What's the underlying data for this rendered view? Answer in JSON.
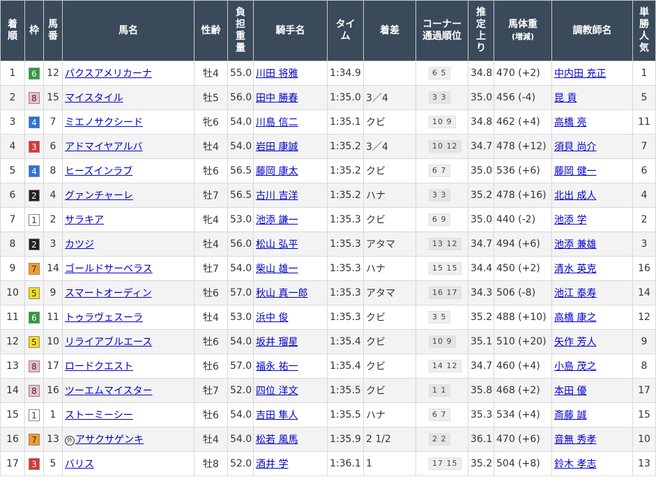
{
  "headers": {
    "rank": [
      "着",
      "順"
    ],
    "waku": [
      "枠"
    ],
    "umaban": [
      "馬",
      "番"
    ],
    "horse": [
      "馬名"
    ],
    "sexage": [
      "性齢"
    ],
    "weight": [
      "負",
      "担",
      "重",
      "量"
    ],
    "jockey": [
      "騎手名"
    ],
    "time": [
      "タイ",
      "ム"
    ],
    "margin": [
      "着差"
    ],
    "corner": [
      "コーナー",
      "通過順位"
    ],
    "last3f": [
      "推",
      "定",
      "上",
      "り"
    ],
    "body_weight": "馬体重",
    "body_weight_sub": "(増減)",
    "trainer": [
      "調教師名"
    ],
    "popularity": [
      "単",
      "勝",
      "人",
      "気"
    ]
  },
  "frame_colors": {
    "1": {
      "bg": "#ffffff",
      "fg": "#333333"
    },
    "2": {
      "bg": "#222222",
      "fg": "#ffffff"
    },
    "3": {
      "bg": "#e03434",
      "fg": "#ffffff"
    },
    "4": {
      "bg": "#2a73d8",
      "fg": "#ffffff"
    },
    "5": {
      "bg": "#f5dd1a",
      "fg": "#333333"
    },
    "6": {
      "bg": "#2f9a3c",
      "fg": "#ffffff"
    },
    "7": {
      "bg": "#f79a26",
      "fg": "#333333"
    },
    "8": {
      "bg": "#f6b8cc",
      "fg": "#333333"
    }
  },
  "rows": [
    {
      "rank": "1",
      "waku": "6",
      "umaban": "12",
      "mark": "",
      "horse": "パクスアメリカーナ",
      "sexage": "牡4",
      "weight": "55.0",
      "jockey": "川田 将雅",
      "time": "1:34.9",
      "margin": "",
      "corner": "6 5",
      "last3f": "34.8",
      "body_weight": "470 (+2)",
      "trainer": "中内田 充正",
      "popularity": "1"
    },
    {
      "rank": "2",
      "waku": "8",
      "umaban": "15",
      "mark": "",
      "horse": "マイスタイル",
      "sexage": "牡5",
      "weight": "56.0",
      "jockey": "田中 勝春",
      "time": "1:35.0",
      "margin": "3／4",
      "corner": "3 3",
      "last3f": "35.0",
      "body_weight": "456 (-4)",
      "trainer": "昆 貢",
      "popularity": "5"
    },
    {
      "rank": "3",
      "waku": "4",
      "umaban": "7",
      "mark": "",
      "horse": "ミエノサクシード",
      "sexage": "牝6",
      "weight": "54.0",
      "jockey": "川島 信二",
      "time": "1:35.1",
      "margin": "クビ",
      "corner": "10 9",
      "last3f": "34.8",
      "body_weight": "462 (+4)",
      "trainer": "高橋 亮",
      "popularity": "11"
    },
    {
      "rank": "4",
      "waku": "3",
      "umaban": "6",
      "mark": "",
      "horse": "アドマイヤアルバ",
      "sexage": "牡4",
      "weight": "54.0",
      "jockey": "岩田 康誠",
      "time": "1:35.2",
      "margin": "3／4",
      "corner": "10 12",
      "last3f": "34.7",
      "body_weight": "478 (+12)",
      "trainer": "須貝 尚介",
      "popularity": "7"
    },
    {
      "rank": "5",
      "waku": "4",
      "umaban": "8",
      "mark": "",
      "horse": "ヒーズインラブ",
      "sexage": "牡6",
      "weight": "56.5",
      "jockey": "藤岡 康太",
      "time": "1:35.2",
      "margin": "クビ",
      "corner": "6 7",
      "last3f": "35.0",
      "body_weight": "536 (+6)",
      "trainer": "藤岡 健一",
      "popularity": "6"
    },
    {
      "rank": "6",
      "waku": "2",
      "umaban": "4",
      "mark": "",
      "horse": "グァンチャーレ",
      "sexage": "牡7",
      "weight": "56.5",
      "jockey": "古川 吉洋",
      "time": "1:35.2",
      "margin": "ハナ",
      "corner": "3 3",
      "last3f": "35.2",
      "body_weight": "478 (+16)",
      "trainer": "北出 成人",
      "popularity": "4"
    },
    {
      "rank": "7",
      "waku": "1",
      "umaban": "2",
      "mark": "",
      "horse": "サラキア",
      "sexage": "牝4",
      "weight": "53.0",
      "jockey": "池添 謙一",
      "time": "1:35.3",
      "margin": "クビ",
      "corner": "6 9",
      "last3f": "35.0",
      "body_weight": "440 (-2)",
      "trainer": "池添 学",
      "popularity": "2"
    },
    {
      "rank": "8",
      "waku": "2",
      "umaban": "3",
      "mark": "",
      "horse": "カツジ",
      "sexage": "牡4",
      "weight": "56.0",
      "jockey": "松山 弘平",
      "time": "1:35.3",
      "margin": "アタマ",
      "corner": "13 12",
      "last3f": "34.7",
      "body_weight": "494 (+6)",
      "trainer": "池添 兼雄",
      "popularity": "3"
    },
    {
      "rank": "9",
      "waku": "7",
      "umaban": "14",
      "mark": "",
      "horse": "ゴールドサーベラス",
      "sexage": "牡7",
      "weight": "54.0",
      "jockey": "柴山 雄一",
      "time": "1:35.3",
      "margin": "ハナ",
      "corner": "15 15",
      "last3f": "34.4",
      "body_weight": "450 (+2)",
      "trainer": "清水 英克",
      "popularity": "16"
    },
    {
      "rank": "10",
      "waku": "5",
      "umaban": "9",
      "mark": "",
      "horse": "スマートオーディン",
      "sexage": "牡6",
      "weight": "57.0",
      "jockey": "秋山 真一郎",
      "time": "1:35.3",
      "margin": "アタマ",
      "corner": "16 17",
      "last3f": "34.3",
      "body_weight": "506 (-8)",
      "trainer": "池江 泰寿",
      "popularity": "14"
    },
    {
      "rank": "11",
      "waku": "6",
      "umaban": "11",
      "mark": "",
      "horse": "トゥラヴェスーラ",
      "sexage": "牡4",
      "weight": "53.0",
      "jockey": "浜中 俊",
      "time": "1:35.3",
      "margin": "クビ",
      "corner": "3 5",
      "last3f": "35.2",
      "body_weight": "488 (+10)",
      "trainer": "高橋 康之",
      "popularity": "12"
    },
    {
      "rank": "12",
      "waku": "5",
      "umaban": "10",
      "mark": "",
      "horse": "リライアブルエース",
      "sexage": "牡6",
      "weight": "54.0",
      "jockey": "坂井 瑠星",
      "time": "1:35.4",
      "margin": "クビ",
      "corner": "10 9",
      "last3f": "35.1",
      "body_weight": "510 (+20)",
      "trainer": "矢作 芳人",
      "popularity": "9"
    },
    {
      "rank": "13",
      "waku": "8",
      "umaban": "17",
      "mark": "",
      "horse": "ロードクエスト",
      "sexage": "牡6",
      "weight": "57.0",
      "jockey": "福永 祐一",
      "time": "1:35.4",
      "margin": "クビ",
      "corner": "14 12",
      "last3f": "34.7",
      "body_weight": "460 (+4)",
      "trainer": "小島 茂之",
      "popularity": "8"
    },
    {
      "rank": "14",
      "waku": "8",
      "umaban": "16",
      "mark": "",
      "horse": "ツーエムマイスター",
      "sexage": "牡7",
      "weight": "52.0",
      "jockey": "四位 洋文",
      "time": "1:35.5",
      "margin": "クビ",
      "corner": "1 1",
      "last3f": "35.8",
      "body_weight": "468 (+2)",
      "trainer": "本田 優",
      "popularity": "17"
    },
    {
      "rank": "15",
      "waku": "1",
      "umaban": "1",
      "mark": "",
      "horse": "ストーミーシー",
      "sexage": "牡6",
      "weight": "54.0",
      "jockey": "吉田 隼人",
      "time": "1:35.5",
      "margin": "ハナ",
      "corner": "6 7",
      "last3f": "35.3",
      "body_weight": "534 (+4)",
      "trainer": "斎藤 誠",
      "popularity": "15"
    },
    {
      "rank": "16",
      "waku": "7",
      "umaban": "13",
      "mark": "外",
      "horse": "アサクサゲンキ",
      "sexage": "牡4",
      "weight": "54.0",
      "jockey": "松若 風馬",
      "time": "1:35.9",
      "margin": "2 1/2",
      "corner": "2 2",
      "last3f": "36.1",
      "body_weight": "470 (+6)",
      "trainer": "音無 秀孝",
      "popularity": "10"
    },
    {
      "rank": "17",
      "waku": "3",
      "umaban": "5",
      "mark": "",
      "horse": "バリス",
      "sexage": "牡8",
      "weight": "52.0",
      "jockey": "酒井 学",
      "time": "1:36.1",
      "margin": "1",
      "corner": "17 15",
      "last3f": "35.2",
      "body_weight": "504 (+8)",
      "trainer": "鈴木 孝志",
      "popularity": "13"
    }
  ]
}
